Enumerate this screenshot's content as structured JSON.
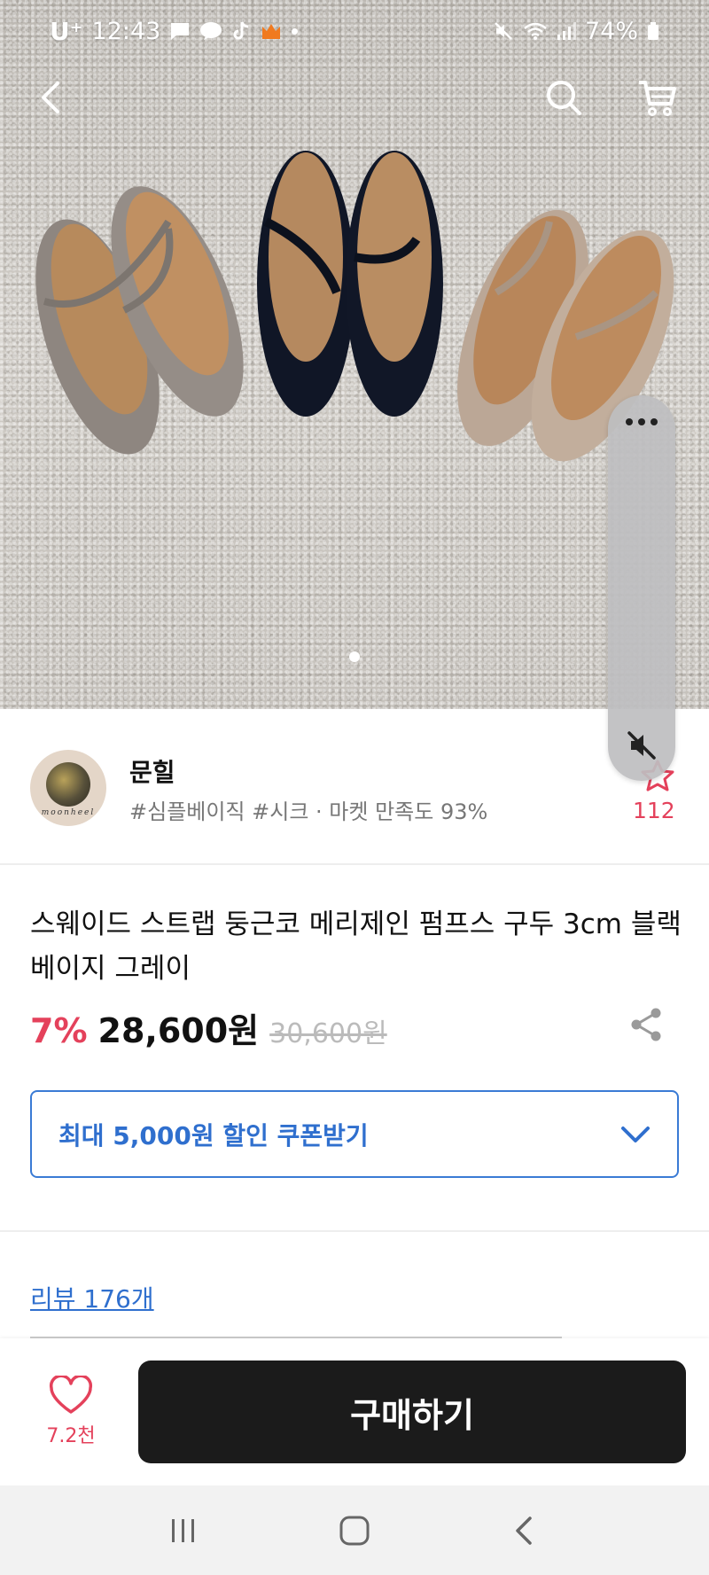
{
  "status_bar": {
    "carrier": "U⁺",
    "time": "12:43",
    "battery": "74%"
  },
  "carousel": {
    "total": 1,
    "current": 1
  },
  "seller": {
    "name": "문힐",
    "logo_text": "moonheel",
    "tags_and_satisfaction": "#심플베이직 #시크 · 마켓 만족도 93%",
    "like_count": "112"
  },
  "product": {
    "title": "스웨이드 스트랩 둥근코 메리제인 펌프스 구두 3cm 블랙 베이지 그레이",
    "discount": "7%",
    "price": "28,600원",
    "original_price": "30,600원"
  },
  "coupon": {
    "label": "최대 5,000원 할인 쿠폰받기"
  },
  "review": {
    "link_label": "리뷰 176개"
  },
  "bottom_bar": {
    "wish_count": "7.2천",
    "buy_label": "구매하기"
  },
  "colors": {
    "accent_red": "#e4415b",
    "coupon_blue": "#2f6fce",
    "buy_button": "#1b1b1b"
  },
  "icons": {
    "back": "chevron-left-icon",
    "search": "search-icon",
    "cart": "cart-icon",
    "share": "share-icon",
    "heart": "heart-icon",
    "mute": "mute-icon",
    "more": "more-icon",
    "chevron": "chevron-down-icon"
  }
}
